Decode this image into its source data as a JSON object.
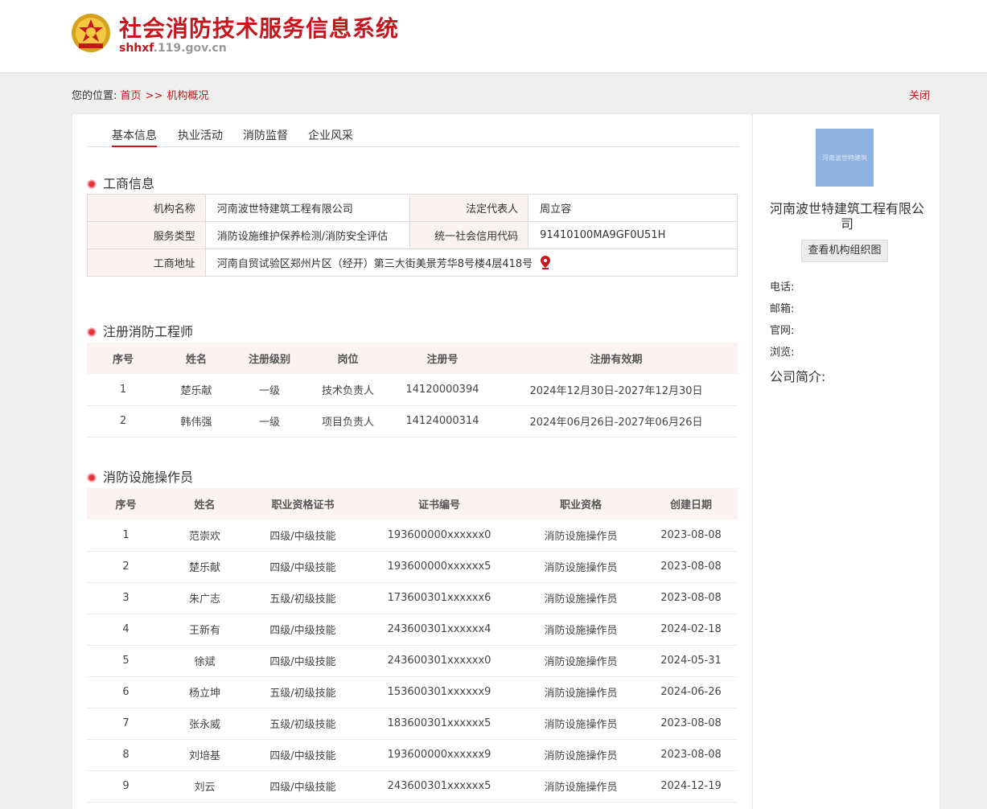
{
  "header": {
    "title": "社会消防技术服务信息系统",
    "domain_bold": "shhxf",
    "domain_rest": ".119.gov.cn"
  },
  "breadcrumb": {
    "prefix": "您的位置:",
    "home": "首页",
    "separator": ">>",
    "current": "机构概况",
    "close": "关闭"
  },
  "tabs": [
    "基本信息",
    "执业活动",
    "消防监督",
    "企业风采"
  ],
  "business": {
    "title": "工商信息",
    "org_name_label": "机构名称",
    "org_name": "河南波世特建筑工程有限公司",
    "legal_rep_label": "法定代表人",
    "legal_rep": "周立容",
    "service_type_label": "服务类型",
    "service_type": "消防设施维护保养检测/消防安全评估",
    "credit_code_label": "统一社会信用代码",
    "credit_code": "91410100MA9GF0U51H",
    "address_label": "工商地址",
    "address": "河南自贸试验区郑州片区（经开）第三大街美景芳华8号楼4层418号"
  },
  "engineers": {
    "title": "注册消防工程师",
    "headers": [
      "序号",
      "姓名",
      "注册级别",
      "岗位",
      "注册号",
      "注册有效期"
    ],
    "rows": [
      [
        "1",
        "楚乐献",
        "一级",
        "技术负责人",
        "14120000394",
        "2024年12月30日-2027年12月30日"
      ],
      [
        "2",
        "韩伟强",
        "一级",
        "项目负责人",
        "14124000314",
        "2024年06月26日-2027年06月26日"
      ]
    ]
  },
  "operators": {
    "title": "消防设施操作员",
    "headers": [
      "序号",
      "姓名",
      "职业资格证书",
      "证书编号",
      "职业资格",
      "创建日期"
    ],
    "rows": [
      [
        "1",
        "范崇欢",
        "四级/中级技能",
        "193600000xxxxxx0",
        "消防设施操作员",
        "2023-08-08"
      ],
      [
        "2",
        "楚乐献",
        "四级/中级技能",
        "193600000xxxxxx5",
        "消防设施操作员",
        "2023-08-08"
      ],
      [
        "3",
        "朱广志",
        "五级/初级技能",
        "173600301xxxxxx6",
        "消防设施操作员",
        "2023-08-08"
      ],
      [
        "4",
        "王新有",
        "四级/中级技能",
        "243600301xxxxxx4",
        "消防设施操作员",
        "2024-02-18"
      ],
      [
        "5",
        "徐斌",
        "四级/中级技能",
        "243600301xxxxxx0",
        "消防设施操作员",
        "2024-05-31"
      ],
      [
        "6",
        "杨立坤",
        "五级/初级技能",
        "153600301xxxxxx9",
        "消防设施操作员",
        "2024-06-26"
      ],
      [
        "7",
        "张永威",
        "五级/初级技能",
        "183600301xxxxxx5",
        "消防设施操作员",
        "2023-08-08"
      ],
      [
        "8",
        "刘培基",
        "四级/中级技能",
        "193600000xxxxxx9",
        "消防设施操作员",
        "2023-08-08"
      ],
      [
        "9",
        "刘云",
        "四级/中级技能",
        "243600301xxxxxx5",
        "消防设施操作员",
        "2024-12-19"
      ]
    ]
  },
  "sidebar": {
    "logo_text": "河南波世特建筑",
    "company_name": "河南波世特建筑工程有限公司",
    "org_chart_button": "查看机构组织图",
    "phone_label": "电话:",
    "email_label": "邮箱:",
    "website_label": "官网:",
    "views_label": "浏览:",
    "intro_label": "公司简介:"
  },
  "colors": {
    "brand_red": "#c4161c",
    "header_bg": "#fdf2f2",
    "logo_blue": "#8eb2e1"
  }
}
